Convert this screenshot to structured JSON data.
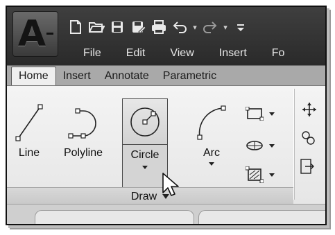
{
  "app": {
    "logo_letter": "A"
  },
  "quick_access": {
    "icons": [
      "new-icon",
      "open-icon",
      "save-icon",
      "save-as-icon",
      "print-icon",
      "undo-icon",
      "redo-icon"
    ]
  },
  "menubar": {
    "items": [
      "File",
      "Edit",
      "View",
      "Insert",
      "Fo"
    ]
  },
  "tabs": [
    "Home",
    "Insert",
    "Annotate",
    "Parametric"
  ],
  "active_tab": "Home",
  "draw_panel": {
    "title": "Draw",
    "tools": {
      "line": "Line",
      "polyline": "Polyline",
      "circle": "Circle",
      "arc": "Arc"
    }
  },
  "colors": {
    "title_bar": "#2f2f2f",
    "tab_strip": "#a9a9a9",
    "ribbon_bg": "#efefef",
    "highlight": "#d6d6d6"
  }
}
